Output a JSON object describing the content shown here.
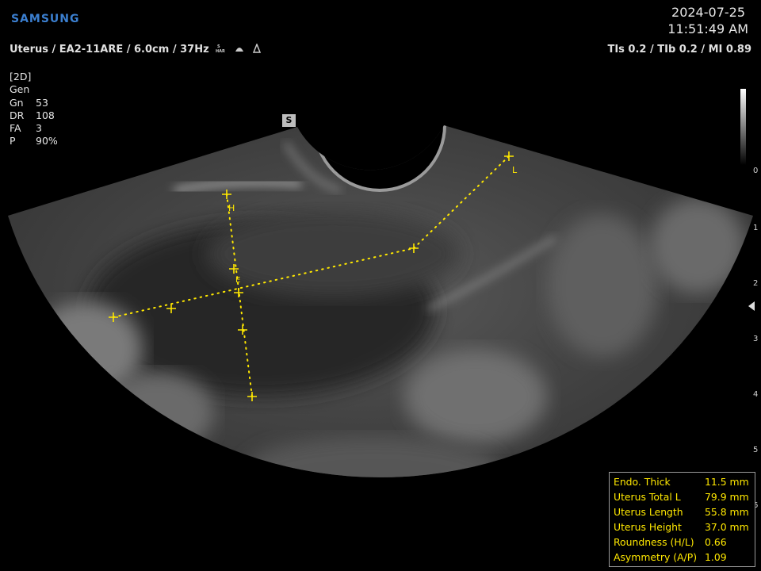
{
  "header": {
    "brand": "SAMSUNG",
    "date": "2024-07-25",
    "time": "11:51:49 AM",
    "params": "Uterus / EA2-11ARE / 6.0cm / 37Hz",
    "index": "TIs  0.2 / TIb  0.2 / MI  0.89"
  },
  "settings": {
    "mode": "[2D]",
    "preset": "Gen",
    "rows": [
      {
        "k": "Gn",
        "v": "53"
      },
      {
        "k": "DR",
        "v": "108"
      },
      {
        "k": "FA",
        "v": "3"
      },
      {
        "k": "P",
        "v": "90%"
      }
    ]
  },
  "marker": "S",
  "depth_ticks": [
    "0",
    "1",
    "2",
    "3",
    "4",
    "5",
    "6"
  ],
  "caliper_labels": {
    "H": "H",
    "L": "L",
    "E": "E"
  },
  "results": [
    {
      "label": "Endo. Thick",
      "value": "11.5 mm"
    },
    {
      "label": "Uterus Total L",
      "value": "79.9 mm"
    },
    {
      "label": "Uterus Length",
      "value": "55.8 mm"
    },
    {
      "label": "Uterus Height",
      "value": "37.0 mm"
    },
    {
      "label": "Roundness (H/L)",
      "value": "0.66"
    },
    {
      "label": "Asymmetry (A/P)",
      "value": "1.09"
    }
  ],
  "colors": {
    "caliper": "#ffe800",
    "brand": "#3b7fd0"
  }
}
